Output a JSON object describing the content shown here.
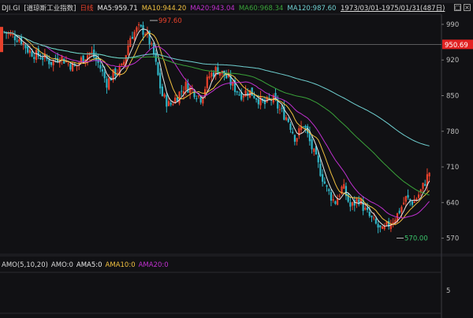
{
  "header": {
    "symbol": "DJI.GI",
    "name": "[道琼斯工业指数]",
    "period": "日线",
    "ma5": "MA5:959.71",
    "ma10": "MA10:944.20",
    "ma20": "MA20:943.04",
    "ma60": "MA60:968.34",
    "ma120": "MA120:987.60",
    "date_range": "1973/03/01-1975/01/31(487日)"
  },
  "amo_legend": {
    "title": "AMO(5,10,20)",
    "amo": "AMO:0",
    "ama5": "AMA5:0",
    "ama10": "AMA10:0",
    "ama20": "AMA20:0"
  },
  "colors": {
    "background": "#111114",
    "up": "#e8412b",
    "down": "#2fb5c6",
    "ma5": "#e8e8e8",
    "ma10": "#f0c040",
    "ma20": "#c030d0",
    "ma60": "#3aa33a",
    "ma120": "#6fcfd0",
    "price_tag": "#e22222"
  },
  "chart_data": {
    "type": "candlestick",
    "ylim": [
      540,
      1010
    ],
    "y_ticks": [
      "990",
      "920",
      "850",
      "780",
      "710",
      "640",
      "570"
    ],
    "current_price_label": "950.69",
    "current_price": 950.69,
    "high_annotation": "997.60",
    "high_value": 997.6,
    "low_annotation": "570.00",
    "low_value": 570.0,
    "sub_tick": "5",
    "close_path": [
      [
        0,
        975
      ],
      [
        0.02,
        968
      ],
      [
        0.04,
        962
      ],
      [
        0.06,
        940
      ],
      [
        0.08,
        930
      ],
      [
        0.1,
        925
      ],
      [
        0.12,
        915
      ],
      [
        0.14,
        928
      ],
      [
        0.16,
        915
      ],
      [
        0.18,
        905
      ],
      [
        0.2,
        925
      ],
      [
        0.22,
        935
      ],
      [
        0.24,
        912
      ],
      [
        0.26,
        875
      ],
      [
        0.28,
        895
      ],
      [
        0.3,
        905
      ],
      [
        0.32,
        965
      ],
      [
        0.34,
        982
      ],
      [
        0.36,
        975
      ],
      [
        0.38,
        930
      ],
      [
        0.4,
        852
      ],
      [
        0.42,
        830
      ],
      [
        0.44,
        850
      ],
      [
        0.46,
        870
      ],
      [
        0.48,
        860
      ],
      [
        0.5,
        845
      ],
      [
        0.52,
        888
      ],
      [
        0.54,
        902
      ],
      [
        0.56,
        890
      ],
      [
        0.58,
        870
      ],
      [
        0.6,
        852
      ],
      [
        0.62,
        860
      ],
      [
        0.64,
        848
      ],
      [
        0.66,
        832
      ],
      [
        0.68,
        845
      ],
      [
        0.7,
        822
      ],
      [
        0.72,
        805
      ],
      [
        0.74,
        765
      ],
      [
        0.76,
        795
      ],
      [
        0.78,
        750
      ],
      [
        0.8,
        708
      ],
      [
        0.82,
        665
      ],
      [
        0.84,
        640
      ],
      [
        0.86,
        672
      ],
      [
        0.88,
        630
      ],
      [
        0.9,
        648
      ],
      [
        0.92,
        620
      ],
      [
        0.94,
        600
      ],
      [
        0.96,
        582
      ],
      [
        0.98,
        600
      ],
      [
        1.0,
        618
      ],
      [
        1.02,
        648
      ],
      [
        1.04,
        640
      ],
      [
        1.06,
        665
      ],
      [
        1.08,
        700
      ]
    ]
  }
}
